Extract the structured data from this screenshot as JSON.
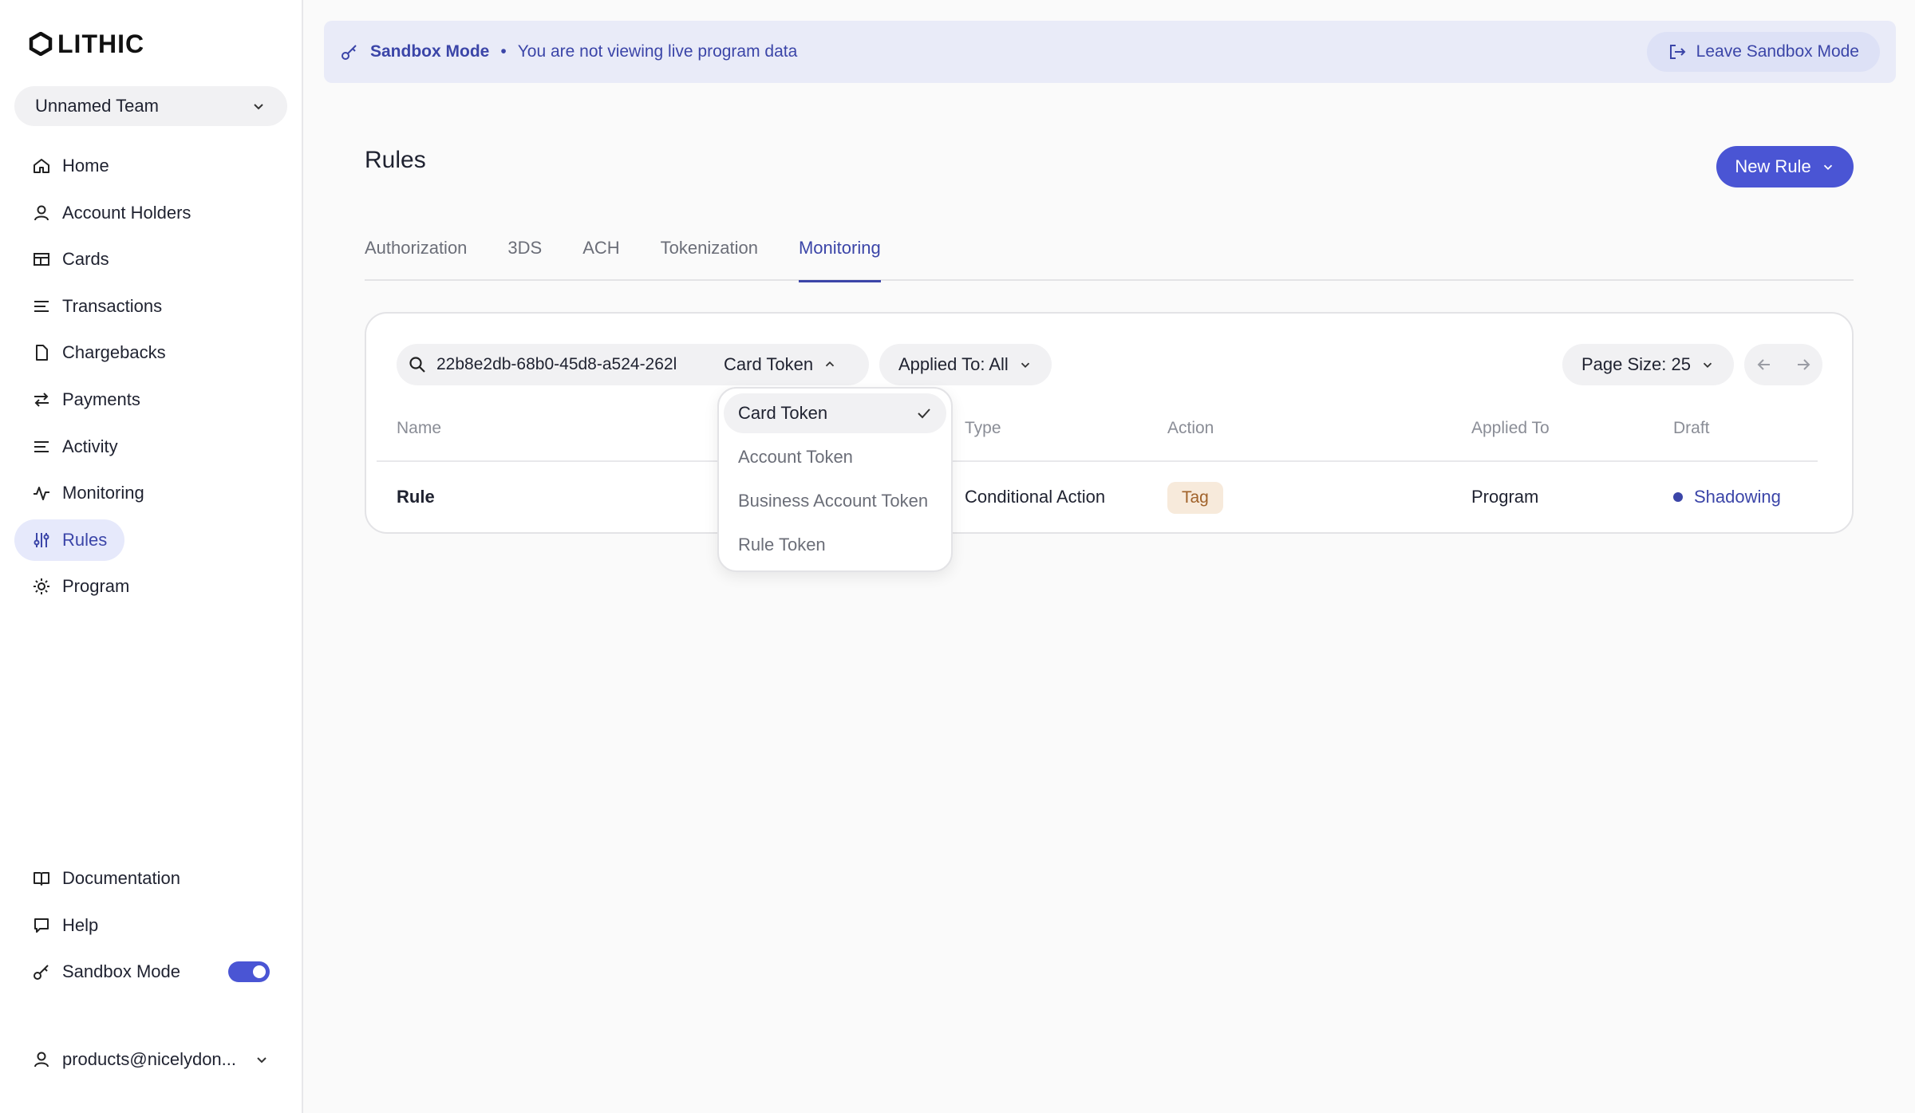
{
  "app": {
    "logo_text": "LITHIC"
  },
  "team": {
    "name": "Unnamed Team"
  },
  "nav": {
    "items": [
      {
        "label": "Home",
        "icon": "home-icon"
      },
      {
        "label": "Account Holders",
        "icon": "user-icon"
      },
      {
        "label": "Cards",
        "icon": "card-icon"
      },
      {
        "label": "Transactions",
        "icon": "list-icon"
      },
      {
        "label": "Chargebacks",
        "icon": "document-icon"
      },
      {
        "label": "Payments",
        "icon": "arrows-icon"
      },
      {
        "label": "Activity",
        "icon": "list-icon"
      },
      {
        "label": "Monitoring",
        "icon": "pulse-icon"
      },
      {
        "label": "Rules",
        "icon": "sliders-icon"
      },
      {
        "label": "Program",
        "icon": "gear-icon"
      }
    ],
    "active": "Rules"
  },
  "bottom_nav": {
    "documentation": "Documentation",
    "help": "Help",
    "sandbox": "Sandbox Mode"
  },
  "user": {
    "email": "products@nicelydon..."
  },
  "banner": {
    "title": "Sandbox Mode",
    "separator": "•",
    "message": "You are not viewing live program data",
    "leave_button": "Leave Sandbox Mode"
  },
  "page": {
    "title": "Rules",
    "new_rule_button": "New Rule"
  },
  "tabs": [
    {
      "label": "Authorization"
    },
    {
      "label": "3DS"
    },
    {
      "label": "ACH"
    },
    {
      "label": "Tokenization"
    },
    {
      "label": "Monitoring"
    }
  ],
  "active_tab": "Monitoring",
  "filters": {
    "search_value": "22b8e2db-68b0-45d8-a524-262l",
    "token_type": "Card Token",
    "applied_to": "Applied To: All",
    "page_size": "Page Size: 25"
  },
  "table": {
    "columns": [
      "Name",
      "Type",
      "Action",
      "Applied To",
      "Draft"
    ],
    "rows": [
      {
        "name": "Rule",
        "type": "Conditional Action",
        "action": "Tag",
        "applied_to": "Program",
        "draft": "Shadowing"
      }
    ]
  },
  "dropdown": {
    "options": [
      "Card Token",
      "Account Token",
      "Business Account Token",
      "Rule Token"
    ],
    "selected": "Card Token"
  },
  "colors": {
    "accent": "#4a55d4",
    "accent_text": "#3b45a8",
    "tag_bg": "#f7eadb",
    "tag_text": "#a0622a"
  }
}
